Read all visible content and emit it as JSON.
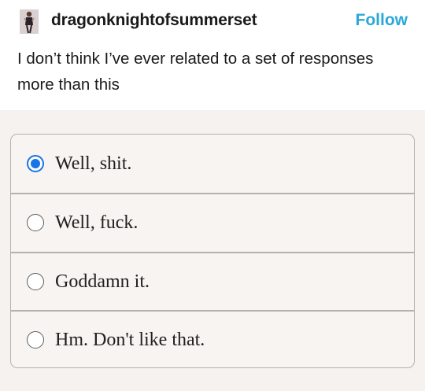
{
  "post": {
    "username": "dragonknightofsummerset",
    "follow_label": "Follow",
    "text": "I don’t think I’ve ever related to a set of responses more than this"
  },
  "poll": {
    "selected_index": 0,
    "options": [
      {
        "label": "Well, shit."
      },
      {
        "label": "Well, fuck."
      },
      {
        "label": "Goddamn it."
      },
      {
        "label": "Hm. Don't like that."
      }
    ]
  },
  "colors": {
    "accent": "#2ba8d8",
    "radio_selected": "#1a73e8",
    "poll_background": "#f5f2ef"
  }
}
